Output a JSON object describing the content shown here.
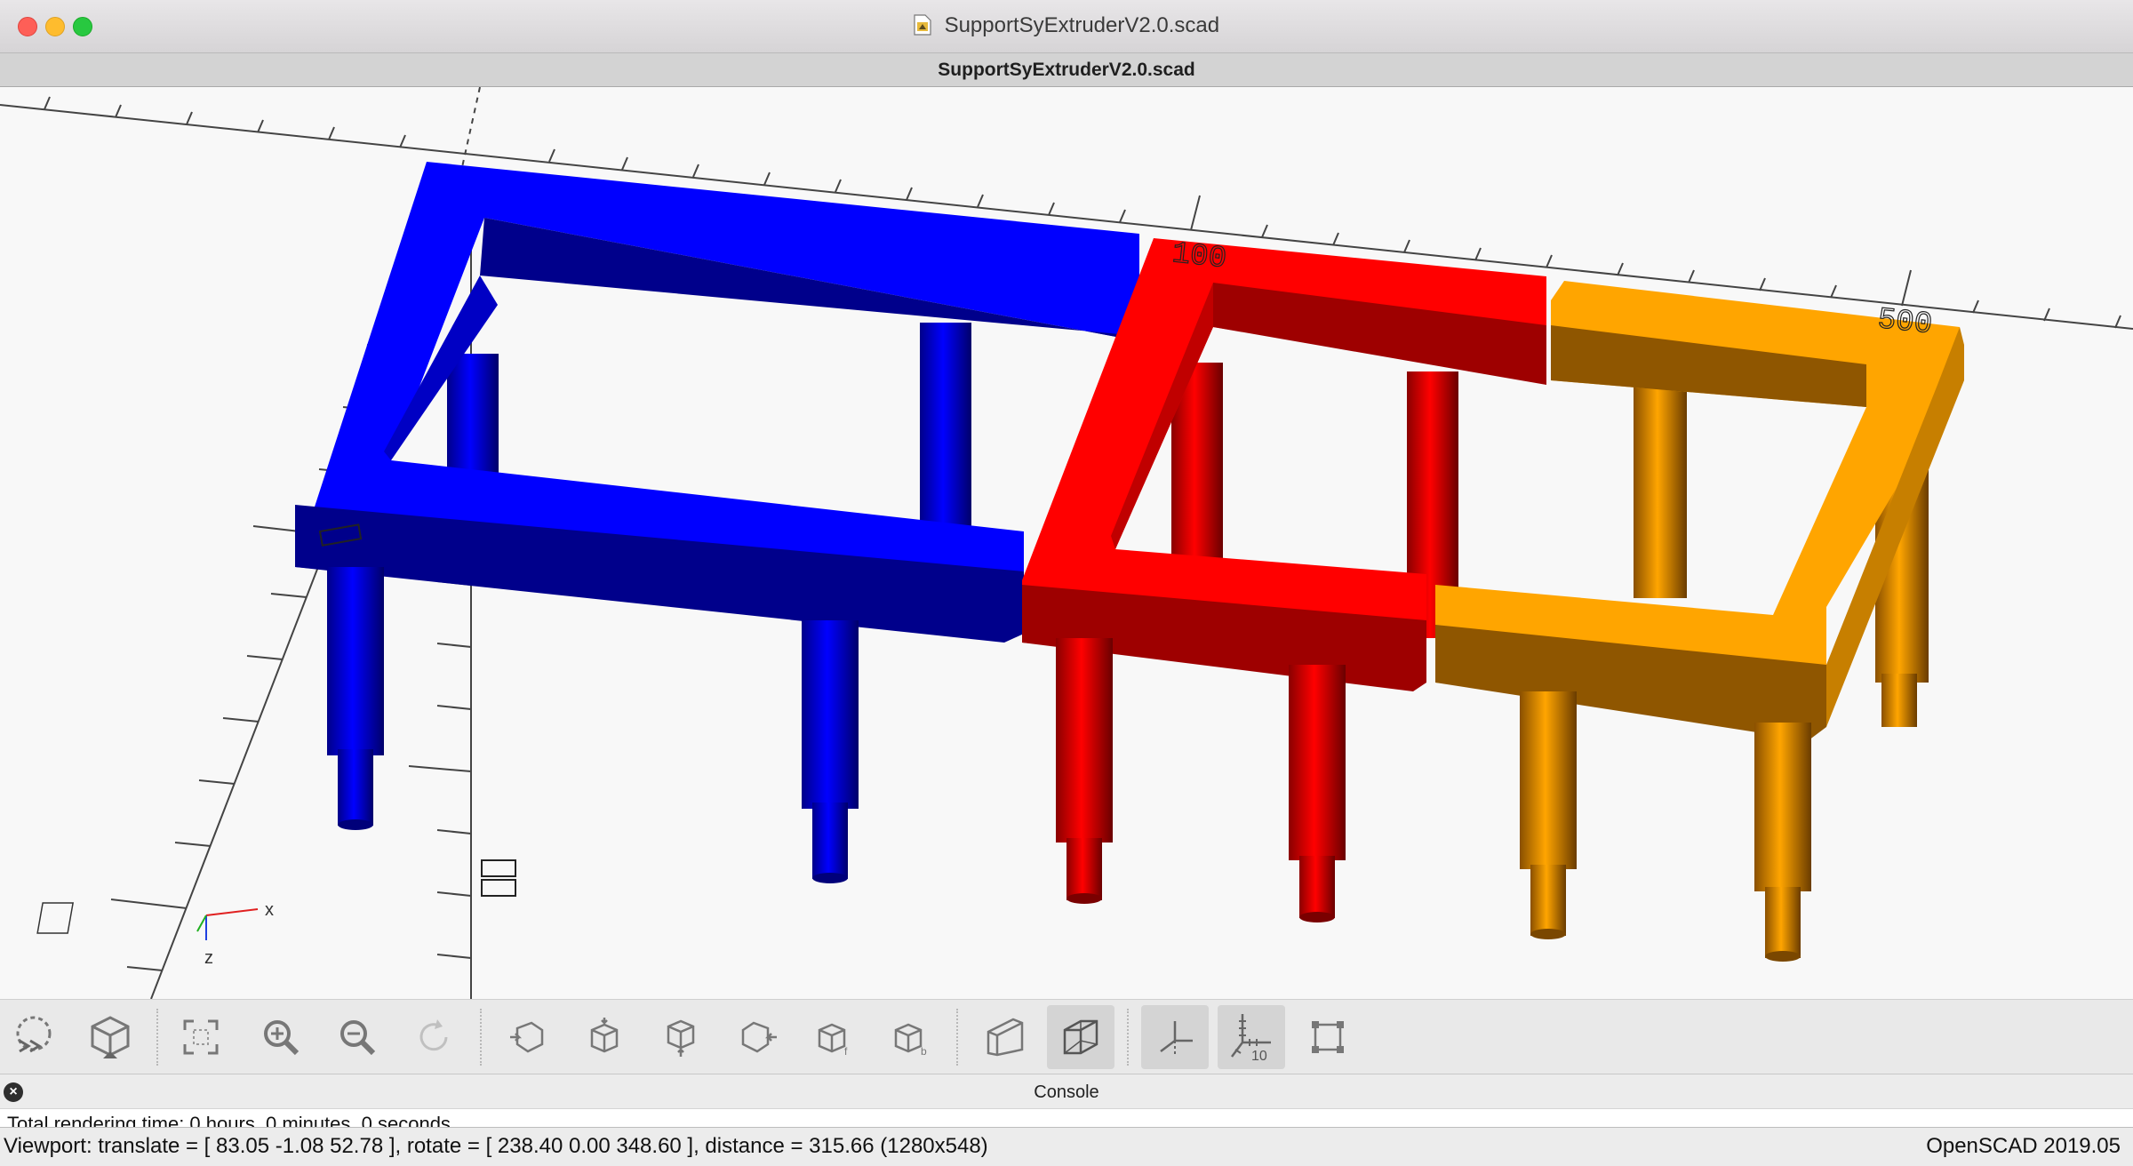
{
  "window": {
    "title": "SupportSyExtruderV2.0.scad",
    "tab_title": "SupportSyExtruderV2.0.scad"
  },
  "viewport": {
    "scale_labels": [
      "100",
      "500"
    ],
    "axis_labels": {
      "x": "x",
      "z": "z"
    },
    "part_colors": {
      "blue": "#0000ff",
      "red": "#ff0000",
      "orange": "#ffa500"
    },
    "background": "#f8f8f8"
  },
  "toolbar": {
    "buttons": [
      {
        "name": "preview-render-icon",
        "state": "normal"
      },
      {
        "name": "render-icon",
        "state": "normal"
      },
      {
        "name": "view-all-icon",
        "state": "normal"
      },
      {
        "name": "zoom-in-icon",
        "state": "normal"
      },
      {
        "name": "zoom-out-icon",
        "state": "normal"
      },
      {
        "name": "reset-view-icon",
        "state": "disabled"
      },
      {
        "name": "view-right-icon",
        "state": "normal"
      },
      {
        "name": "view-top-icon",
        "state": "normal"
      },
      {
        "name": "view-bottom-icon",
        "state": "normal"
      },
      {
        "name": "view-left-icon",
        "state": "normal"
      },
      {
        "name": "view-front-icon",
        "state": "normal"
      },
      {
        "name": "view-back-icon",
        "state": "normal"
      },
      {
        "name": "perspective-icon",
        "state": "normal"
      },
      {
        "name": "orthogonal-icon",
        "state": "active"
      },
      {
        "name": "show-axes-icon",
        "state": "active"
      },
      {
        "name": "show-scale-markers-icon",
        "state": "active"
      },
      {
        "name": "show-edges-icon",
        "state": "normal"
      }
    ],
    "scale_marker_label": "10"
  },
  "console": {
    "title": "Console",
    "close_label": "×",
    "line": "Total rendering time: 0 hours, 0 minutes, 0 seconds"
  },
  "statusbar": {
    "viewport_info": "Viewport: translate = [ 83.05 -1.08 52.78 ], rotate = [ 238.40 0.00 348.60 ], distance = 315.66 (1280x548)",
    "version": "OpenSCAD 2019.05"
  }
}
